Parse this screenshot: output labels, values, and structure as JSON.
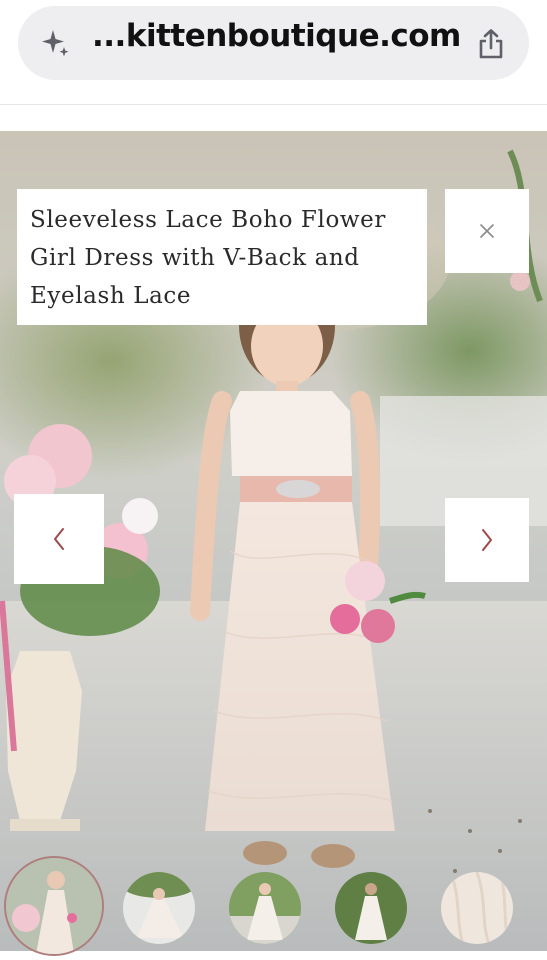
{
  "browser": {
    "url": "...kittenboutique.com",
    "assistant_icon": "sparkle-icon",
    "share_icon": "share-icon"
  },
  "gallery": {
    "title": "Sleeveless Lace Boho Flower Girl Dress with V-Back and Eyelash Lace",
    "close_icon": "close-icon",
    "prev_icon": "chevron-left-icon",
    "next_icon": "chevron-right-icon",
    "accent_color": "#9b4b4b",
    "thumbnail_count": 5,
    "active_thumbnail": 1
  }
}
